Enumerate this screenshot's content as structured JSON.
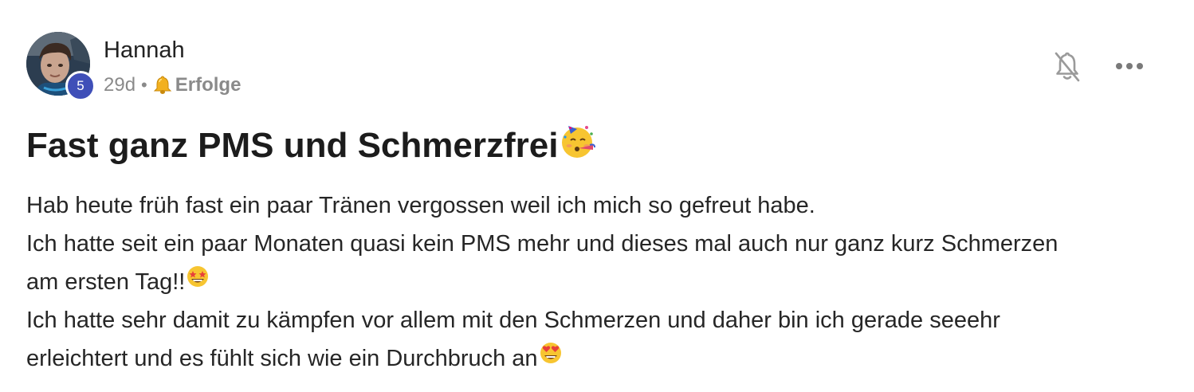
{
  "post": {
    "author": {
      "name": "Hannah",
      "level": "5"
    },
    "meta": {
      "age": "29d",
      "separator": "•",
      "category_icon": "bell-emoji",
      "category": "Erfolge"
    },
    "actions": {
      "mute_icon": "bell-slash-icon",
      "more_icon": "more-horizontal-icon"
    },
    "title": "Fast ganz PMS und Schmerzfrei",
    "title_emoji": "partying-face-emoji",
    "body_lines": [
      "Hab heute früh fast ein paar Tränen vergossen weil ich mich so gefreut habe.",
      "Ich hatte seit ein paar Monaten quasi kein PMS mehr und dieses mal auch nur ganz kurz Schmerzen",
      "am ersten Tag!!",
      "Ich hatte sehr damit zu kämpfen vor allem mit den Schmerzen und daher bin ich gerade seeehr",
      "erleichtert und es fühlt sich wie ein Durchbruch an"
    ],
    "line3_emoji": "star-struck-emoji",
    "line5_emoji": "heart-eyes-emoji",
    "colors": {
      "badge": "#3f4fb8",
      "meta_text": "#8a8a8a",
      "text": "#262626"
    }
  }
}
